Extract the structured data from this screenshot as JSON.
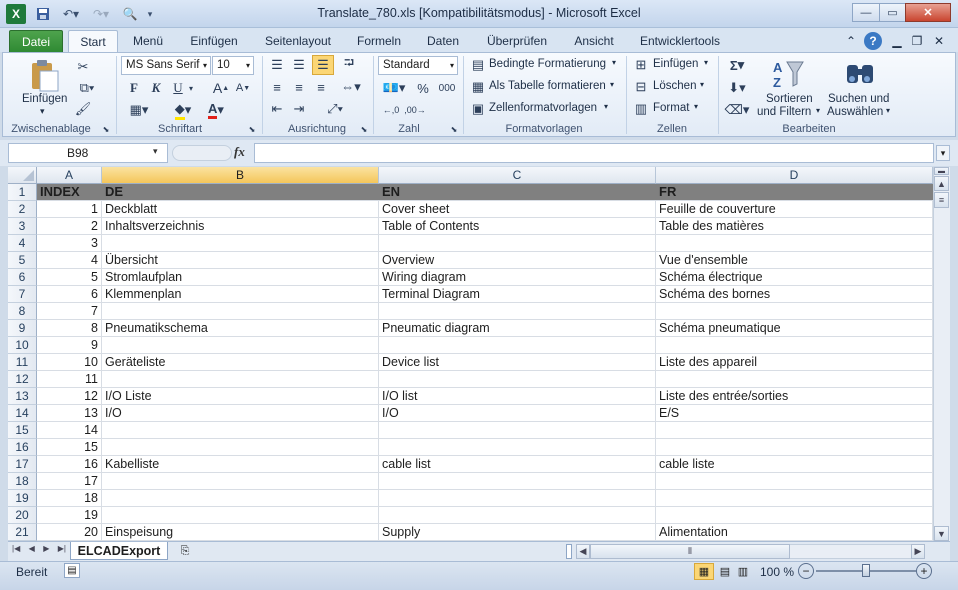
{
  "window": {
    "title": "Translate_780.xls  [Kompatibilitätsmodus]  -  Microsoft Excel"
  },
  "qat": {
    "icons": [
      "excel-logo",
      "save",
      "undo",
      "redo",
      "print-preview",
      "customize"
    ]
  },
  "tabs": [
    "Datei",
    "Start",
    "Menü",
    "Einfügen",
    "Seitenlayout",
    "Formeln",
    "Daten",
    "Überprüfen",
    "Ansicht",
    "Entwicklertools"
  ],
  "active_tab": "Start",
  "ribbon": {
    "clipboard": {
      "paste_label": "Einfügen",
      "group_label": "Zwischenablage"
    },
    "font": {
      "font_name": "MS Sans Serif",
      "font_size": "10",
      "bold": "F",
      "italic": "K",
      "underline": "U",
      "group_label": "Schriftart"
    },
    "alignment": {
      "group_label": "Ausrichtung"
    },
    "number": {
      "format": "Standard",
      "percent": "%",
      "thousands": "000",
      "group_label": "Zahl"
    },
    "styles": {
      "conditional": "Bedingte Formatierung",
      "as_table": "Als Tabelle formatieren",
      "cell_styles": "Zellenformatvorlagen",
      "group_label": "Formatvorlagen"
    },
    "cells": {
      "insert": "Einfügen",
      "delete": "Löschen",
      "format": "Format",
      "group_label": "Zellen"
    },
    "editing": {
      "sort_line1": "Sortieren",
      "sort_line2": "und Filtern",
      "find_line1": "Suchen und",
      "find_line2": "Auswählen",
      "sigma": "Σ",
      "group_label": "Bearbeiten"
    }
  },
  "formula_bar": {
    "name_box": "B98",
    "fx": "fx",
    "formula": ""
  },
  "columns": [
    "A",
    "B",
    "C",
    "D"
  ],
  "selected_column": "B",
  "rows": [
    {
      "n": "1",
      "a": "INDEX",
      "b": "DE",
      "c": "EN",
      "d": "FR"
    },
    {
      "n": "2",
      "a": "1",
      "b": "Deckblatt",
      "c": "Cover sheet",
      "d": "Feuille de couverture"
    },
    {
      "n": "3",
      "a": "2",
      "b": "Inhaltsverzeichnis",
      "c": "Table of Contents",
      "d": "Table des matières"
    },
    {
      "n": "4",
      "a": "3",
      "b": "",
      "c": "",
      "d": ""
    },
    {
      "n": "5",
      "a": "4",
      "b": "Übersicht",
      "c": "Overview",
      "d": "Vue d'ensemble"
    },
    {
      "n": "6",
      "a": "5",
      "b": "Stromlaufplan",
      "c": "Wiring diagram",
      "d": "Schéma électrique"
    },
    {
      "n": "7",
      "a": "6",
      "b": "Klemmenplan",
      "c": "Terminal Diagram",
      "d": "Schéma des bornes"
    },
    {
      "n": "8",
      "a": "7",
      "b": "",
      "c": "",
      "d": ""
    },
    {
      "n": "9",
      "a": "8",
      "b": "Pneumatikschema",
      "c": "Pneumatic diagram",
      "d": "Schéma pneumatique"
    },
    {
      "n": "10",
      "a": "9",
      "b": "",
      "c": "",
      "d": ""
    },
    {
      "n": "11",
      "a": "10",
      "b": "Geräteliste",
      "c": "Device list",
      "d": "Liste des appareil"
    },
    {
      "n": "12",
      "a": "11",
      "b": "",
      "c": "",
      "d": ""
    },
    {
      "n": "13",
      "a": "12",
      "b": "I/O Liste",
      "c": "I/O list",
      "d": "Liste des entrée/sorties"
    },
    {
      "n": "14",
      "a": "13",
      "b": "I/O",
      "c": "I/O",
      "d": "E/S"
    },
    {
      "n": "15",
      "a": "14",
      "b": "",
      "c": "",
      "d": ""
    },
    {
      "n": "16",
      "a": "15",
      "b": "",
      "c": "",
      "d": ""
    },
    {
      "n": "17",
      "a": "16",
      "b": "Kabelliste",
      "c": "cable list",
      "d": "cable liste"
    },
    {
      "n": "18",
      "a": "17",
      "b": "",
      "c": "",
      "d": ""
    },
    {
      "n": "19",
      "a": "18",
      "b": "",
      "c": "",
      "d": ""
    },
    {
      "n": "20",
      "a": "19",
      "b": "",
      "c": "",
      "d": ""
    },
    {
      "n": "21",
      "a": "20",
      "b": "Einspeisung",
      "c": "Supply",
      "d": "Alimentation"
    }
  ],
  "sheet_tab": "ELCADExport",
  "status": {
    "ready": "Bereit",
    "zoom": "100 %",
    "zoom_fraction": 0.5
  }
}
